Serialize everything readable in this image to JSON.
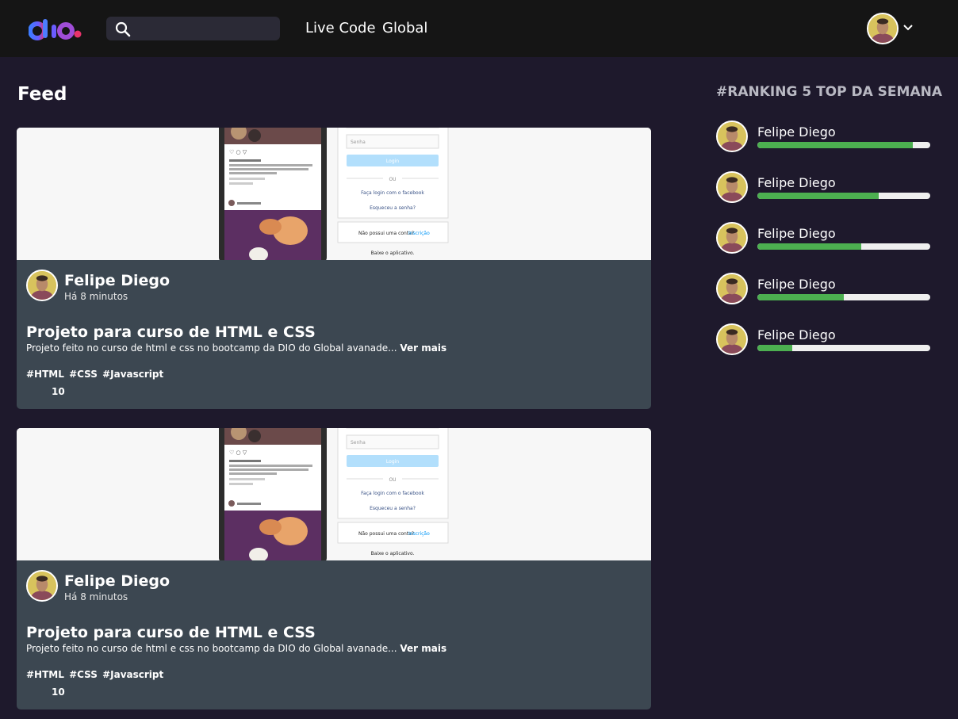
{
  "brand": {
    "accent_blue": "#3d7bff",
    "accent_pink": "#e8336b"
  },
  "nav": {
    "live_code": "Live Code",
    "global": "Global"
  },
  "search": {
    "placeholder": "",
    "value": ""
  },
  "feed": {
    "title": "Feed",
    "posts": [
      {
        "author": "Felipe Diego",
        "time": "Há 8 minutos",
        "title": "Projeto para curso de HTML e CSS",
        "description": "Projeto feito no curso de html e css no bootcamp da DIO do Global avanade...",
        "more": "Ver mais",
        "tags": [
          "#HTML",
          "#CSS",
          "#Javascript"
        ],
        "likes": "10"
      },
      {
        "author": "Felipe Diego",
        "time": "Há 8 minutos",
        "title": "Projeto para curso de HTML e CSS",
        "description": "Projeto feito no curso de html e css no bootcamp da DIO do Global avanade...",
        "more": "Ver mais",
        "tags": [
          "#HTML",
          "#CSS",
          "#Javascript"
        ],
        "likes": "10"
      }
    ]
  },
  "ranking": {
    "title": "#RANKING 5 TOP DA SEMANA",
    "bar_color": "#4caf50",
    "items": [
      {
        "name": "Felipe Diego",
        "progress": 0.9
      },
      {
        "name": "Felipe Diego",
        "progress": 0.7
      },
      {
        "name": "Felipe Diego",
        "progress": 0.6
      },
      {
        "name": "Felipe Diego",
        "progress": 0.5
      },
      {
        "name": "Felipe Diego",
        "progress": 0.2
      }
    ]
  },
  "post_image_texts": {
    "password_placeholder": "Senha",
    "login_button": "Login",
    "or": "OU",
    "facebook_login": "Faça login com o facebook",
    "forgot_password": "Esqueceu a senha?",
    "no_account": "Não possui uma conta?",
    "signup": "Inscrição",
    "download_app": "Baixe o aplicativo."
  }
}
